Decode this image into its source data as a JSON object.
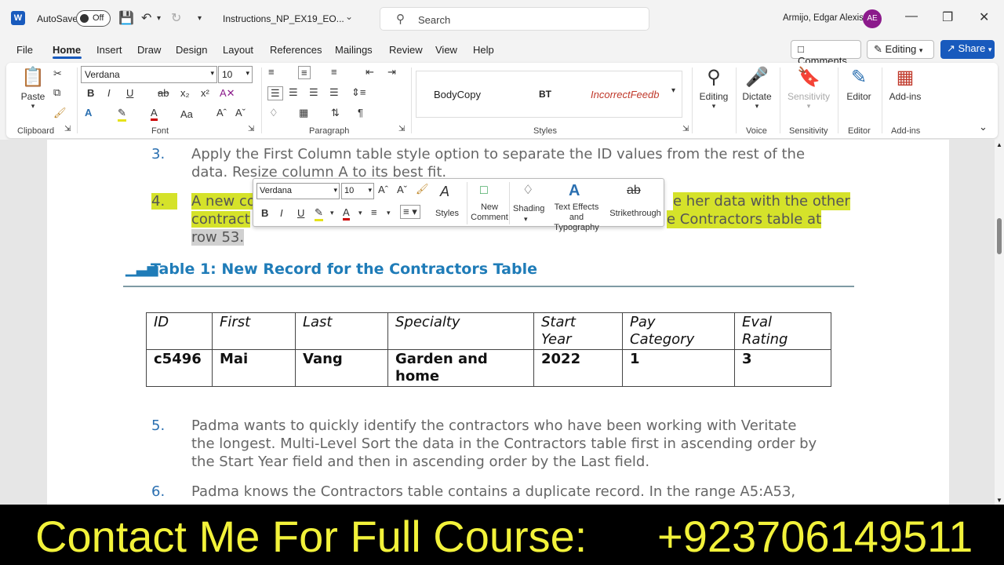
{
  "titlebar": {
    "logo_letter": "W",
    "autosave_label": "AutoSave",
    "autosave_state": "Off",
    "doc_name": "Instructions_NP_EX19_EO...",
    "search_placeholder": "Search",
    "user_name": "Armijo, Edgar Alexis",
    "user_initials": "AE"
  },
  "tabs": [
    "File",
    "Home",
    "Insert",
    "Draw",
    "Design",
    "Layout",
    "References",
    "Mailings",
    "Review",
    "View",
    "Help"
  ],
  "active_tab": "Home",
  "actions": {
    "comments": "Comments",
    "editing": "Editing",
    "share": "Share"
  },
  "ribbon": {
    "clipboard": {
      "paste": "Paste",
      "label": "Clipboard"
    },
    "font": {
      "name": "Verdana",
      "size": "10",
      "label": "Font"
    },
    "paragraph": {
      "label": "Paragraph"
    },
    "styles": {
      "items": [
        "BodyCopy",
        "BT",
        "IncorrectFeedb"
      ],
      "label": "Styles"
    },
    "editing": {
      "label": "Editing"
    },
    "voice": {
      "button": "Dictate",
      "label": "Voice"
    },
    "sensitivity": {
      "button": "Sensitivity",
      "label": "Sensitivity"
    },
    "editor": {
      "button": "Editor",
      "label": "Editor"
    },
    "addins": {
      "button": "Add-ins",
      "label": "Add-ins"
    }
  },
  "document": {
    "items": [
      {
        "num": "3.",
        "lines": [
          "Apply the First Column table style option to separate the ID values from the rest of the",
          "data. Resize column A to its best fit."
        ]
      },
      {
        "num": "4.",
        "line1_a": "A new co",
        "line1_b": "e her data with the other",
        "line2_a": "contract",
        "line2_b": "e Contractors table at",
        "line3": "row 53."
      },
      {
        "num": "5.",
        "lines": [
          "Padma wants to quickly identify the contractors who have been working with Veritate",
          "the longest. Multi-Level Sort the data in the Contractors table first in ascending order by",
          "the Start Year field and then in ascending order by the Last field."
        ]
      },
      {
        "num": "6.",
        "lines": [
          "Padma knows the Contractors table contains a duplicate record. In the range A5:A53,"
        ]
      }
    ],
    "table_heading": "Table 1: New Record for the Contractors Table",
    "table": {
      "headers": [
        [
          "ID"
        ],
        [
          "First"
        ],
        [
          "Last"
        ],
        [
          "Specialty"
        ],
        [
          "Start",
          "Year"
        ],
        [
          "Pay",
          "Category"
        ],
        [
          "Eval",
          "Rating"
        ]
      ],
      "row": [
        [
          "c5496"
        ],
        [
          "Mai"
        ],
        [
          "Vang"
        ],
        [
          "Garden and",
          "home"
        ],
        [
          "2022"
        ],
        [
          "1"
        ],
        [
          "3"
        ]
      ]
    }
  },
  "mini_toolbar": {
    "font": "Verdana",
    "size": "10",
    "styles": "Styles",
    "new_comment_1": "New",
    "new_comment_2": "Comment",
    "shading": "Shading",
    "text_effects_1": "Text Effects and",
    "text_effects_2": "Typography",
    "strikethrough": "Strikethrough"
  },
  "banner": {
    "left": "Contact Me For Full Course:",
    "right": "+923706149511"
  }
}
